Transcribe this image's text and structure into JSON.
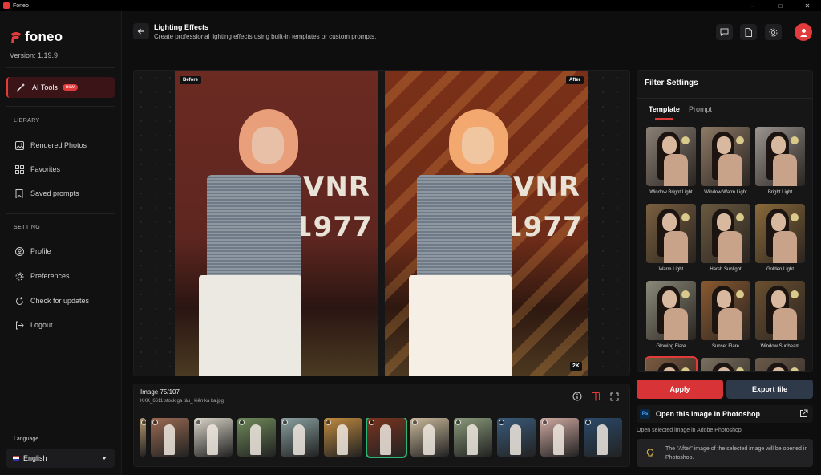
{
  "window": {
    "title": "Foneo",
    "minimize": "–",
    "maximize": "□",
    "close": "✕"
  },
  "brand": {
    "name": "foneo",
    "version": "Version: 1.19.9"
  },
  "sidebar": {
    "ai_tools": {
      "label": "AI Tools",
      "badge": "new"
    },
    "library_heading": "LIBRARY",
    "library_items": [
      {
        "label": "Rendered Photos",
        "icon": "image-icon"
      },
      {
        "label": "Favorites",
        "icon": "grid-icon"
      },
      {
        "label": "Saved prompts",
        "icon": "bookmark-icon"
      }
    ],
    "setting_heading": "SETTING",
    "setting_items": [
      {
        "label": "Profile",
        "icon": "user-icon"
      },
      {
        "label": "Preferences",
        "icon": "gear-icon"
      },
      {
        "label": "Check for updates",
        "icon": "refresh-icon"
      },
      {
        "label": "Logout",
        "icon": "logout-icon"
      }
    ],
    "language_label": "Language",
    "language_value": "English"
  },
  "header": {
    "title": "Lighting Effects",
    "subtitle": "Create professional lighting effects using built-in templates or custom prompts."
  },
  "preview": {
    "before_tag": "Before",
    "after_tag": "After",
    "resolution_tag": "2K",
    "vnr_text": "VNR",
    "year_text": "1977"
  },
  "image_info": {
    "count": "Image 75/107",
    "filename": "KKK_6611 stock ga tàu_ kiên ka ka.jpg"
  },
  "filmstrip": {
    "thumbnails": 12,
    "selected_index": 6,
    "colors": [
      "#b89a70",
      "#9a6a52",
      "#d9d4c8",
      "#6f8a5a",
      "#8aa0a0",
      "#c08a40",
      "#7a3420",
      "#c9b89a",
      "#8a9a7a",
      "#3a5a7a",
      "#cfa8a0",
      "#2a4a6a"
    ]
  },
  "filter_settings": {
    "title": "Filter Settings",
    "tabs": [
      "Template",
      "Prompt"
    ],
    "templates": [
      {
        "label": "Window Bright Light",
        "bg": "#8a8076"
      },
      {
        "label": "Window Warm Light",
        "bg": "#8e7a66"
      },
      {
        "label": "Bright Light",
        "bg": "#9a9590"
      },
      {
        "label": "Warm Light",
        "bg": "#7a6040"
      },
      {
        "label": "Harsh Sunlight",
        "bg": "#6a5a40"
      },
      {
        "label": "Golden Light",
        "bg": "#8a6a3a"
      },
      {
        "label": "Glowing Flare",
        "bg": "#8a8a7a"
      },
      {
        "label": "Sunset Flare",
        "bg": "#8a5a30"
      },
      {
        "label": "Window Sunbeam",
        "bg": "#6a5030"
      },
      {
        "label": "",
        "bg": "#7a5a40"
      },
      {
        "label": "",
        "bg": "#7a7060"
      },
      {
        "label": "",
        "bg": "#6a5a4a"
      }
    ]
  },
  "actions": {
    "apply": "Apply",
    "export": "Export file",
    "photoshop_badge": "Ps",
    "photoshop_label": "Open this image in Photoshop",
    "photoshop_desc": "Open selected image in Adobe Photoshop.",
    "note": "The \"After\" image of the selected image will be opened in Photoshop."
  },
  "colors": {
    "accent": "#e23b3b",
    "export": "#2e3a4a",
    "selected_thumb": "#2bb673"
  }
}
